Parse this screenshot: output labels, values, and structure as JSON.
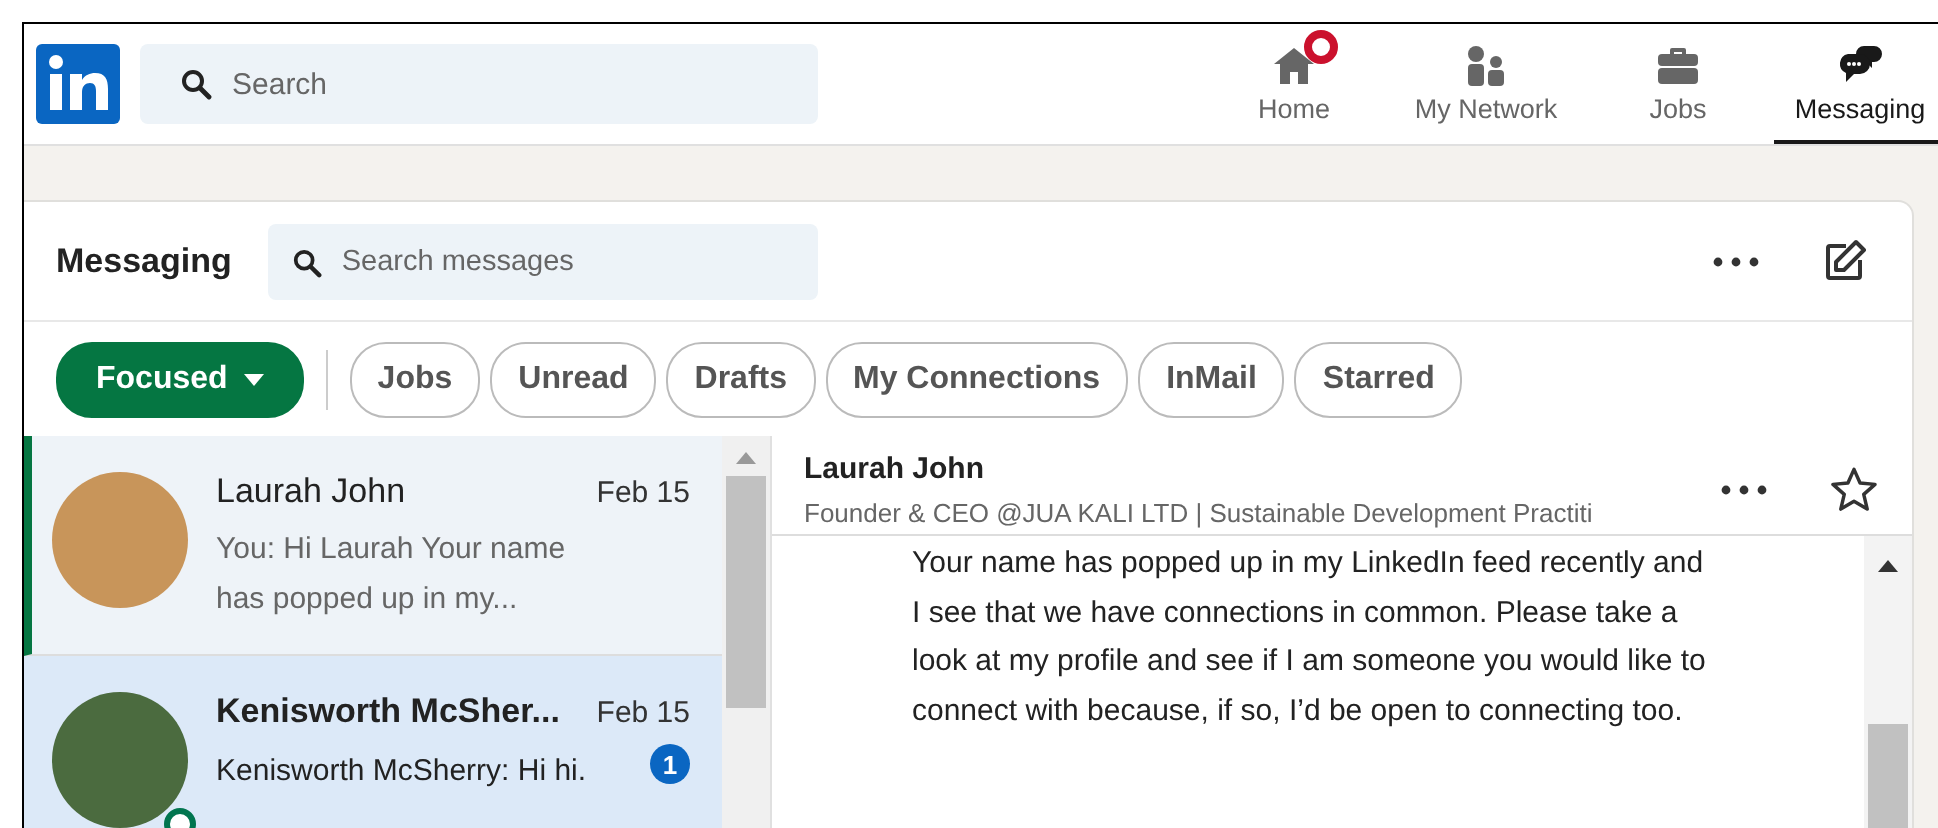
{
  "top_nav": {
    "search": {
      "placeholder": "Search"
    },
    "items": [
      {
        "label": "Home",
        "selected": false,
        "notification": true
      },
      {
        "label": "My Network",
        "selected": false,
        "notification": false
      },
      {
        "label": "Jobs",
        "selected": false,
        "notification": false
      },
      {
        "label": "Messaging",
        "selected": true,
        "notification": false
      }
    ]
  },
  "messaging": {
    "title": "Messaging",
    "search": {
      "placeholder": "Search messages"
    },
    "filters": [
      {
        "label": "Focused",
        "selected": true
      },
      {
        "label": "Jobs",
        "selected": false
      },
      {
        "label": "Unread",
        "selected": false
      },
      {
        "label": "Drafts",
        "selected": false
      },
      {
        "label": "My Connections",
        "selected": false
      },
      {
        "label": "InMail",
        "selected": false
      },
      {
        "label": "Starred",
        "selected": false
      }
    ],
    "conversations": [
      {
        "name": "Laurah John",
        "date": "Feb 15",
        "preview": "You: Hi Laurah Your name has popped up in my...",
        "selected": true,
        "unread": false,
        "online": false
      },
      {
        "name": "Kenisworth McSher...",
        "date": "Feb 15",
        "preview": "Kenisworth McSherry: Hi hi.",
        "selected": false,
        "unread": true,
        "online": true,
        "unread_count": "1"
      }
    ],
    "thread": {
      "name": "Laurah John",
      "headline": "Founder & CEO @JUA KALI LTD | Sustainable Development Practiti",
      "message": "Your name has popped up in my LinkedIn feed recently and I see that we have connections in common. Please take a look at my profile and see if I am someone you would like to connect with because, if so, I’d be open to connecting too."
    }
  }
}
